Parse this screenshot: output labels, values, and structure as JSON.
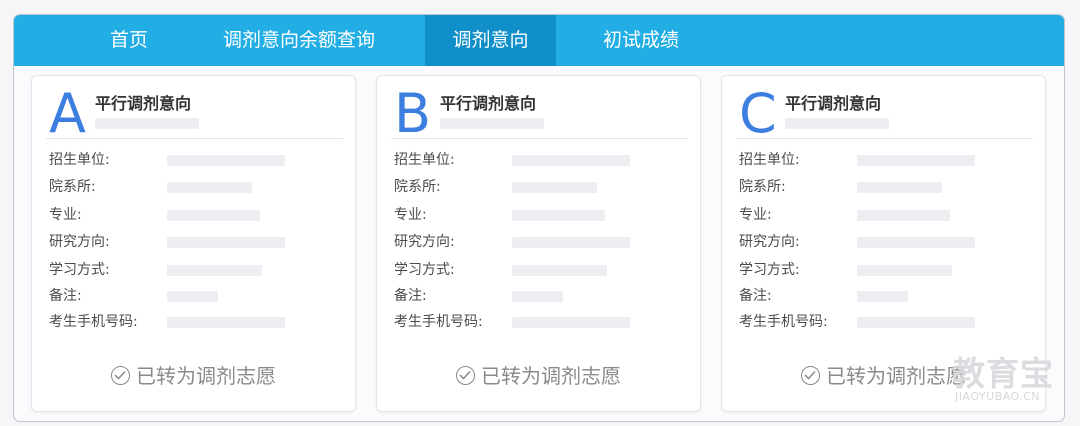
{
  "nav": {
    "items": [
      {
        "label": "首页",
        "active": false
      },
      {
        "label": "调剂意向余额查询",
        "active": false
      },
      {
        "label": "调剂意向",
        "active": true
      },
      {
        "label": "初试成绩",
        "active": false
      }
    ]
  },
  "cards": [
    {
      "letter": "A",
      "title": "平行调剂意向",
      "fields": [
        "招生单位:",
        "院系所:",
        "专业:",
        "研究方向:",
        "学习方式:",
        "备注:",
        "考生手机号码:"
      ],
      "status": "已转为调剂志愿"
    },
    {
      "letter": "B",
      "title": "平行调剂意向",
      "fields": [
        "招生单位:",
        "院系所:",
        "专业:",
        "研究方向:",
        "学习方式:",
        "备注:",
        "考生手机号码:"
      ],
      "status": "已转为调剂志愿"
    },
    {
      "letter": "C",
      "title": "平行调剂意向",
      "fields": [
        "招生单位:",
        "院系所:",
        "专业:",
        "研究方向:",
        "学习方式:",
        "备注:",
        "考生手机号码:"
      ],
      "status": "已转为调剂志愿"
    }
  ],
  "watermark": {
    "logo_text": "教育宝",
    "url_text": "JIAOYUBAO.CN"
  },
  "colors": {
    "nav_bg": "#22aee5",
    "nav_active_bg": "#108fc8",
    "letter": "#3d7fe0"
  }
}
